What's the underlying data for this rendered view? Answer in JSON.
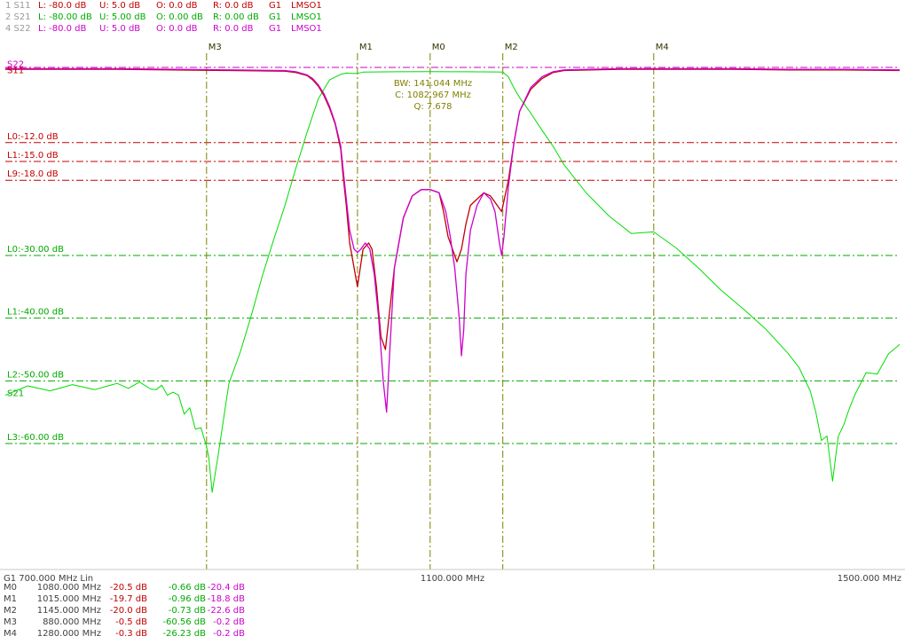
{
  "header": {
    "rows": [
      {
        "id": "1 S11",
        "color": "#c00000",
        "L": "L: -80.0 dB",
        "U": "U: 5.0 dB",
        "O": "O: 0.0 dB",
        "R": "R: 0.0 dB",
        "G": "G1",
        "src": "LMSO1"
      },
      {
        "id": "2 S21",
        "color": "#00aa00",
        "L": "L: -80.00 dB",
        "U": "U: 5.00 dB",
        "O": "O: 0.00 dB",
        "R": "R: 0.00 dB",
        "G": "G1",
        "src": "LMSO1"
      },
      {
        "id": "4 S22",
        "color": "#cc00cc",
        "L": "L: -80.0 dB",
        "U": "U: 5.0 dB",
        "O": "O: 0.0 dB",
        "R": "R: 0.0 dB",
        "G": "G1",
        "src": "LMSO1"
      }
    ]
  },
  "chart_data": {
    "type": "line",
    "x_unit": "MHz",
    "xlim": [
      700,
      1500
    ],
    "ylim": [
      -80,
      5
    ],
    "grid": false,
    "trace_labels": [
      {
        "text": "S22",
        "color": "#cc00cc",
        "y": 0.5
      },
      {
        "text": "S11",
        "color": "#c00000",
        "y": -0.5
      },
      {
        "text": "S21",
        "color": "#00aa00",
        "y": -52
      }
    ],
    "limit_lines": [
      {
        "label": "L0:-12.0 dB",
        "y": -12,
        "color": "#c00000"
      },
      {
        "label": "L1:-15.0 dB",
        "y": -15,
        "color": "#c00000"
      },
      {
        "label": "L9:-18.0 dB",
        "y": -18,
        "color": "#c00000"
      },
      {
        "label": "L0:-30.00 dB",
        "y": -30,
        "color": "#00aa00"
      },
      {
        "label": "L1:-40.00 dB",
        "y": -40,
        "color": "#00aa00"
      },
      {
        "label": "L2:-50.00 dB",
        "y": -50,
        "color": "#00aa00"
      },
      {
        "label": "L3:-60.00 dB",
        "y": -60,
        "color": "#00aa00"
      }
    ],
    "reference_line": {
      "y": 0,
      "color": "#cc00cc"
    },
    "markers": [
      {
        "name": "M0",
        "x": 1080
      },
      {
        "name": "M1",
        "x": 1015
      },
      {
        "name": "M2",
        "x": 1145
      },
      {
        "name": "M3",
        "x": 880
      },
      {
        "name": "M4",
        "x": 1280
      }
    ],
    "annotation": {
      "bw": "BW: 141.044 MHz",
      "center": "C: 1082.967 MHz",
      "q": "Q: 7.678",
      "color": "#808000"
    },
    "series": [
      {
        "name": "S21",
        "color": "#00dd00",
        "x": [
          700,
          720,
          740,
          760,
          780,
          800,
          810,
          820,
          830,
          835,
          840,
          845,
          850,
          855,
          860,
          865,
          870,
          875,
          880,
          882,
          885,
          890,
          900,
          910,
          920,
          930,
          940,
          950,
          960,
          970,
          980,
          990,
          1000,
          1005,
          1010,
          1015,
          1020,
          1050,
          1080,
          1110,
          1140,
          1145,
          1150,
          1155,
          1160,
          1170,
          1180,
          1190,
          1200,
          1220,
          1240,
          1260,
          1280,
          1300,
          1320,
          1340,
          1360,
          1380,
          1400,
          1410,
          1420,
          1425,
          1430,
          1435,
          1437,
          1440,
          1445,
          1450,
          1455,
          1460,
          1470,
          1480,
          1490,
          1500
        ],
        "y": [
          -52.3,
          -50.8,
          -51.6,
          -50.6,
          -51.4,
          -50.4,
          -51.2,
          -50.2,
          -51.3,
          -51.4,
          -50.7,
          -52.3,
          -51.8,
          -52.3,
          -55.3,
          -54.3,
          -57.7,
          -57.5,
          -60.5,
          -62.2,
          -67.8,
          -62.3,
          -50.4,
          -45.5,
          -39.6,
          -33.2,
          -27.5,
          -22.1,
          -16.0,
          -10.3,
          -5.0,
          -2.0,
          -1.1,
          -0.9,
          -0.95,
          -0.96,
          -0.75,
          -0.7,
          -0.66,
          -0.7,
          -0.72,
          -0.73,
          -1.5,
          -3.3,
          -4.8,
          -7.3,
          -10.0,
          -12.6,
          -15.6,
          -20.1,
          -23.7,
          -26.5,
          -26.23,
          -28.8,
          -32.0,
          -35.5,
          -38.5,
          -41.7,
          -45.6,
          -47.9,
          -51.6,
          -55.0,
          -59.5,
          -58.8,
          -61.7,
          -66.0,
          -58.9,
          -57.0,
          -54.4,
          -52.2,
          -48.7,
          -48.9,
          -45.7,
          -44.2
        ]
      },
      {
        "name": "S11",
        "color": "#c00000",
        "x": [
          700,
          800,
          850,
          900,
          950,
          960,
          970,
          975,
          980,
          985,
          990,
          995,
          1000,
          1002,
          1005,
          1008,
          1012,
          1015,
          1020,
          1025,
          1028,
          1032,
          1036,
          1040,
          1048,
          1056,
          1064,
          1072,
          1080,
          1088,
          1092,
          1096,
          1100,
          1104,
          1108,
          1112,
          1116,
          1122,
          1128,
          1134,
          1140,
          1144,
          1150,
          1155,
          1160,
          1170,
          1180,
          1190,
          1200,
          1250,
          1300,
          1350,
          1400,
          1450,
          1500
        ],
        "y": [
          -0.3,
          -0.3,
          -0.4,
          -0.5,
          -0.6,
          -0.8,
          -1.3,
          -2.0,
          -3.0,
          -4.5,
          -6.5,
          -9.0,
          -13.0,
          -17.0,
          -22.0,
          -28.0,
          -32.0,
          -35.0,
          -29.0,
          -28.0,
          -29.0,
          -35.0,
          -43.0,
          -45.0,
          -32.0,
          -24.0,
          -20.5,
          -19.5,
          -19.5,
          -20.0,
          -23.0,
          -27.0,
          -29.0,
          -31.0,
          -29.0,
          -25.0,
          -22.0,
          -21.0,
          -20.0,
          -20.5,
          -22.0,
          -23.0,
          -18.0,
          -12.0,
          -7.0,
          -3.5,
          -1.8,
          -0.8,
          -0.5,
          -0.3,
          -0.3,
          -0.3,
          -0.4,
          -0.4,
          -0.5
        ]
      },
      {
        "name": "S22",
        "color": "#cc00cc",
        "x": [
          700,
          800,
          850,
          900,
          950,
          960,
          970,
          975,
          980,
          985,
          990,
          995,
          1000,
          1002,
          1005,
          1008,
          1012,
          1015,
          1018,
          1022,
          1026,
          1030,
          1034,
          1038,
          1041,
          1044,
          1048,
          1056,
          1064,
          1072,
          1080,
          1088,
          1094,
          1098,
          1102,
          1106,
          1108,
          1110,
          1112,
          1116,
          1122,
          1128,
          1134,
          1138,
          1142,
          1144,
          1146,
          1150,
          1155,
          1160,
          1170,
          1180,
          1190,
          1200,
          1250,
          1300,
          1350,
          1400,
          1450,
          1500
        ],
        "y": [
          -0.2,
          -0.2,
          -0.3,
          -0.4,
          -0.5,
          -0.7,
          -1.2,
          -1.8,
          -2.8,
          -4.2,
          -6.2,
          -8.8,
          -12.5,
          -16.0,
          -21.0,
          -26.0,
          -29.0,
          -29.5,
          -29.0,
          -28.0,
          -29.0,
          -33.0,
          -40.0,
          -50.0,
          -55.0,
          -45.0,
          -32.0,
          -24.0,
          -20.5,
          -19.5,
          -19.5,
          -20.0,
          -23.0,
          -27.0,
          -32.0,
          -40.0,
          -46.0,
          -42.0,
          -33.0,
          -26.0,
          -22.0,
          -20.0,
          -21.0,
          -23.0,
          -28.0,
          -30.0,
          -27.0,
          -19.0,
          -12.0,
          -7.0,
          -3.2,
          -1.5,
          -0.7,
          -0.4,
          -0.2,
          -0.2,
          -0.2,
          -0.3,
          -0.3,
          -0.4
        ]
      }
    ],
    "x_labels": {
      "left": "G1   700.000 MHz   Lin",
      "center": "1100.000 MHz",
      "right": "1500.000 MHz"
    }
  },
  "marker_table": {
    "rows": [
      {
        "name": "M0",
        "freq": "1080.000 MHz",
        "s11": "-20.5 dB",
        "s21": "-0.66 dB",
        "s22": "-20.4 dB"
      },
      {
        "name": "M1",
        "freq": "1015.000 MHz",
        "s11": "-19.7 dB",
        "s21": "-0.96 dB",
        "s22": "-18.8 dB"
      },
      {
        "name": "M2",
        "freq": "1145.000 MHz",
        "s11": "-20.0 dB",
        "s21": "-0.73 dB",
        "s22": "-22.6 dB"
      },
      {
        "name": "M3",
        "freq": "880.000 MHz",
        "s11": "-0.5 dB",
        "s21": "-60.56 dB",
        "s22": "-0.2 dB"
      },
      {
        "name": "M4",
        "freq": "1280.000 MHz",
        "s11": "-0.3 dB",
        "s21": "-26.23 dB",
        "s22": "-0.2 dB"
      }
    ]
  }
}
